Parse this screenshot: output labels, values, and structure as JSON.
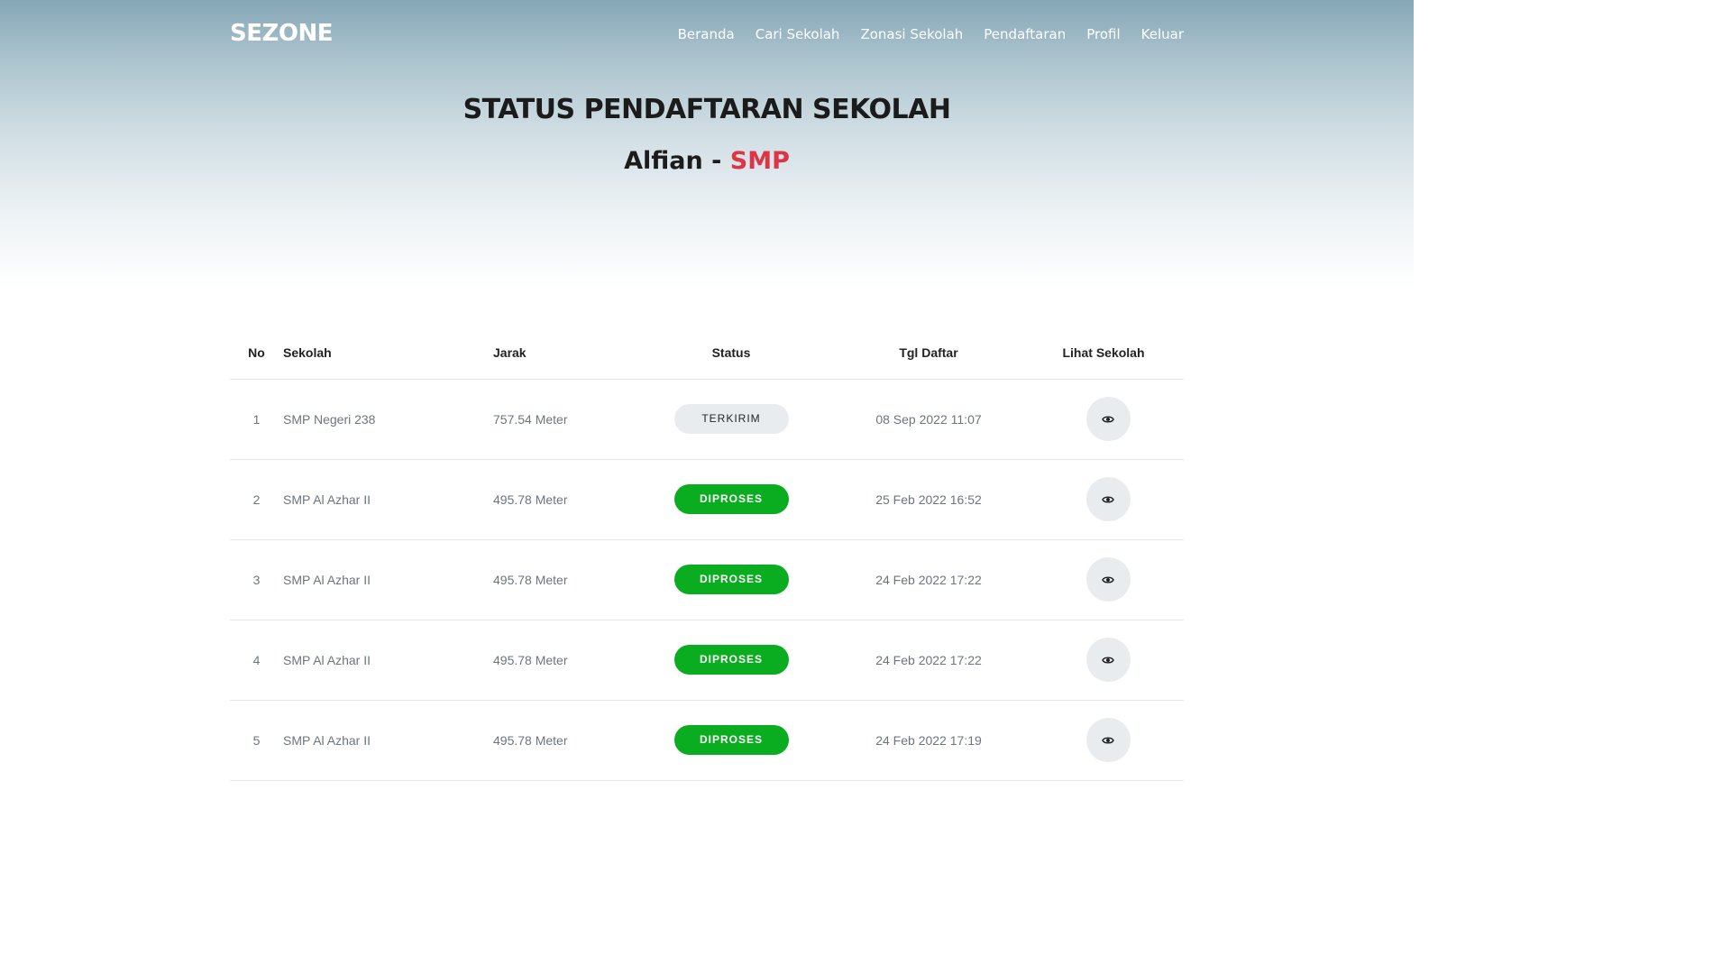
{
  "brand": "SEZONE",
  "nav": [
    "Beranda",
    "Cari Sekolah",
    "Zonasi Sekolah",
    "Pendaftaran",
    "Profil",
    "Keluar"
  ],
  "page_title": "STATUS PENDAFTARAN SEKOLAH",
  "student": {
    "name": "Alfian",
    "separator": " - ",
    "level": "SMP"
  },
  "colors": {
    "level_accent": "#dc3545",
    "status_sent": "#e9ecef",
    "status_processing": "#0aad1f"
  },
  "table": {
    "headers": {
      "no": "No",
      "sekolah": "Sekolah",
      "jarak": "Jarak",
      "status": "Status",
      "tgl": "Tgl Daftar",
      "lihat": "Lihat Sekolah"
    },
    "rows": [
      {
        "no": "1",
        "sekolah": "SMP Negeri 238",
        "jarak": "757.54 Meter",
        "status": "TERKIRIM",
        "tgl": "08 Sep 2022 11:07",
        "action_icon": "eye-icon"
      },
      {
        "no": "2",
        "sekolah": "SMP Al Azhar II",
        "jarak": "495.78 Meter",
        "status": "DIPROSES",
        "tgl": "25 Feb 2022 16:52",
        "action_icon": "eye-icon"
      },
      {
        "no": "3",
        "sekolah": "SMP Al Azhar II",
        "jarak": "495.78 Meter",
        "status": "DIPROSES",
        "tgl": "24 Feb 2022 17:22",
        "action_icon": "eye-icon"
      },
      {
        "no": "4",
        "sekolah": "SMP Al Azhar II",
        "jarak": "495.78 Meter",
        "status": "DIPROSES",
        "tgl": "24 Feb 2022 17:22",
        "action_icon": "eye-icon"
      },
      {
        "no": "5",
        "sekolah": "SMP Al Azhar II",
        "jarak": "495.78 Meter",
        "status": "DIPROSES",
        "tgl": "24 Feb 2022 17:19",
        "action_icon": "eye-icon"
      }
    ]
  }
}
